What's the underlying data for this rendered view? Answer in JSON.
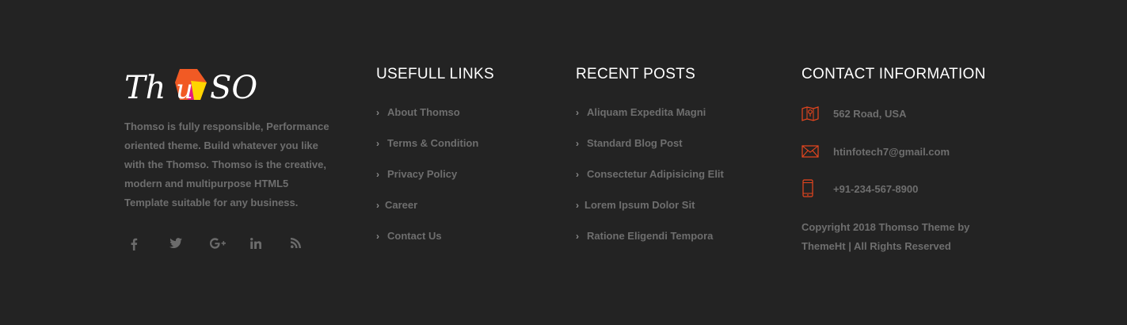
{
  "brand": {
    "logo_text_left": "Th",
    "logo_text_mid": "M",
    "logo_text_right": "SO",
    "logo_alt": "Thomso",
    "accent": "#f15a24",
    "accent2": "#ffd400",
    "accent3": "#e6197e"
  },
  "about": {
    "text": "Thomso is fully responsible, Performance oriented theme. Build whatever you like with the Thomso. Thomso is the creative, modern and multipurpose HTML5 Template suitable for any business.",
    "social": [
      "facebook-icon",
      "twitter-icon",
      "google-plus-icon",
      "linkedin-icon",
      "rss-icon"
    ]
  },
  "links": {
    "heading": "USEFULL LINKS",
    "items": [
      "About Thomso",
      "Terms & Condition",
      "Privacy Policy",
      "Career",
      "Contact Us"
    ]
  },
  "posts": {
    "heading": "RECENT POSTS",
    "items": [
      "Aliquam Expedita Magni",
      "Standard Blog Post",
      "Consectetur Adipisicing Elit",
      "Lorem Ipsum Dolor Sit",
      "Ratione Eligendi Tempora"
    ]
  },
  "contact": {
    "heading": "CONTACT INFORMATION",
    "address": "562 Road, USA",
    "email": "htinfotech7@gmail.com",
    "phone": "+91-234-567-8900",
    "copyright": "Copyright 2018 Thomso Theme by ThemeHt | All Rights Reserved",
    "icons": [
      "map-icon",
      "mail-icon",
      "phone-icon"
    ],
    "icon_color": "#e8461e"
  }
}
